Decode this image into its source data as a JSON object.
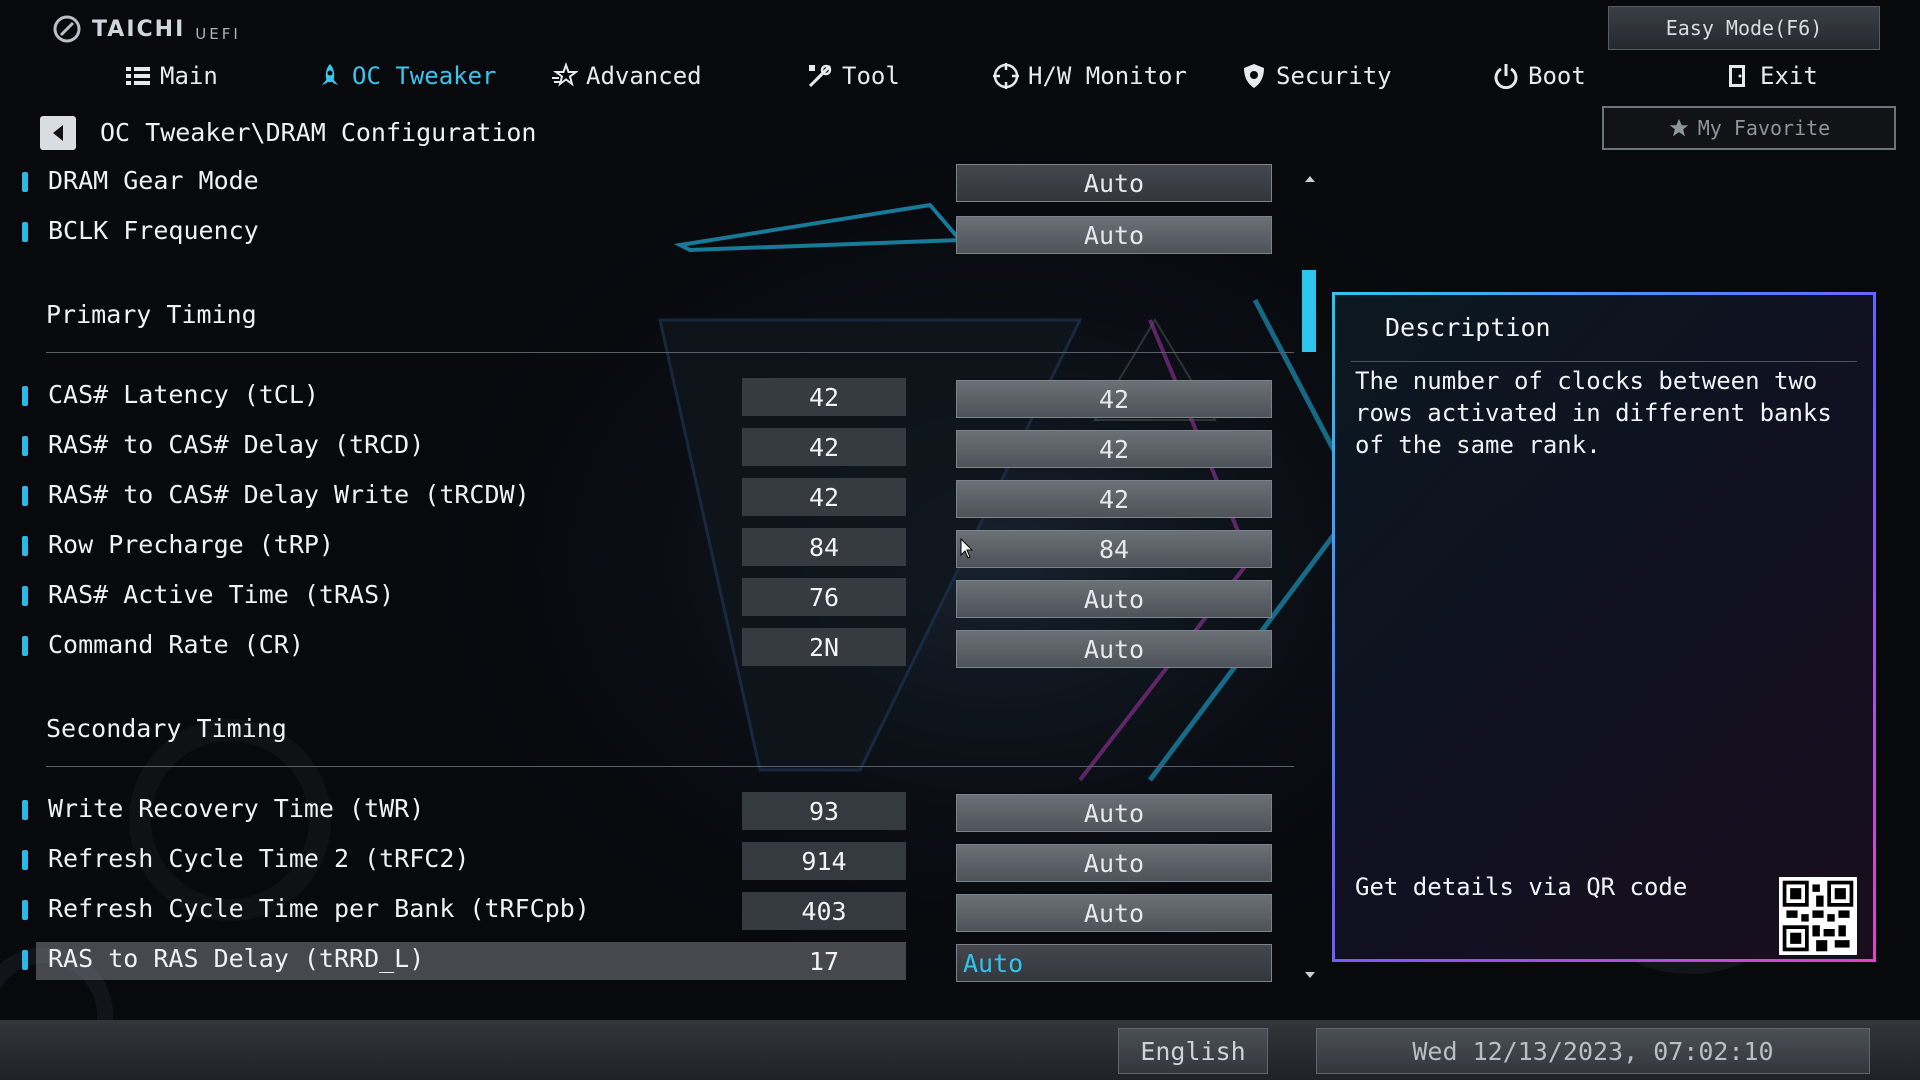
{
  "brand": {
    "name": "TAICHI",
    "sub": "UEFI"
  },
  "easy_mode_label": "Easy Mode(F6)",
  "favorite_label": "My Favorite",
  "nav": [
    {
      "label": "Main",
      "icon": "list-icon"
    },
    {
      "label": "OC Tweaker",
      "icon": "rocket-icon",
      "active": true
    },
    {
      "label": "Advanced",
      "icon": "star-icon"
    },
    {
      "label": "Tool",
      "icon": "tools-icon"
    },
    {
      "label": "H/W Monitor",
      "icon": "crosshair-icon"
    },
    {
      "label": "Security",
      "icon": "shield-icon"
    },
    {
      "label": "Boot",
      "icon": "power-icon"
    },
    {
      "label": "Exit",
      "icon": "exit-door-icon"
    }
  ],
  "breadcrumb": "OC Tweaker\\DRAM Configuration",
  "rows_top": [
    {
      "label": "DRAM Gear Mode",
      "setting": "Auto"
    },
    {
      "label": "BCLK Frequency",
      "setting": "Auto"
    }
  ],
  "primary_title": "Primary Timing",
  "primary": [
    {
      "label": "CAS# Latency (tCL)",
      "current": "42",
      "setting": "42"
    },
    {
      "label": "RAS# to CAS# Delay (tRCD)",
      "current": "42",
      "setting": "42"
    },
    {
      "label": "RAS# to CAS# Delay Write (tRCDW)",
      "current": "42",
      "setting": "42"
    },
    {
      "label": "Row Precharge (tRP)",
      "current": "84",
      "setting": "84"
    },
    {
      "label": "RAS# Active Time (tRAS)",
      "current": "76",
      "setting": "Auto"
    },
    {
      "label": "Command Rate (CR)",
      "current": "2N",
      "setting": "Auto"
    }
  ],
  "secondary_title": "Secondary Timing",
  "secondary": [
    {
      "label": "Write Recovery Time (tWR)",
      "current": "93",
      "setting": "Auto"
    },
    {
      "label": "Refresh Cycle Time 2 (tRFC2)",
      "current": "914",
      "setting": "Auto"
    },
    {
      "label": "Refresh Cycle Time per Bank (tRFCpb)",
      "current": "403",
      "setting": "Auto"
    },
    {
      "label": "RAS to RAS Delay (tRRD_L)",
      "current": "17",
      "setting": "Auto"
    }
  ],
  "description": {
    "title": "Description",
    "text": "The number of clocks between two rows activated in different banks of the same rank.",
    "qr_text": "Get details via QR code"
  },
  "footer": {
    "language": "English",
    "datetime": "Wed 12/13/2023, 07:02:10"
  },
  "colors": {
    "accent": "#2fc4ee",
    "border_start": "#2fc4ee",
    "border_end": "#e043c9"
  }
}
